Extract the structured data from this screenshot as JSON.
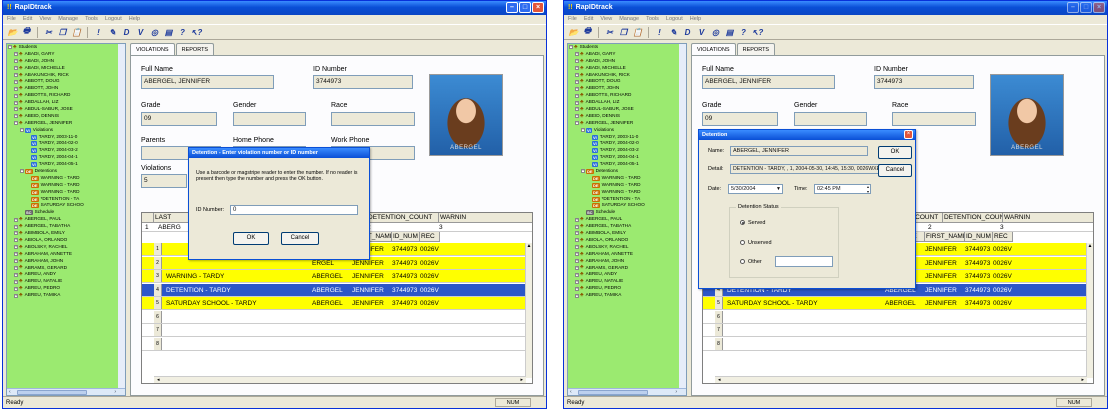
{
  "app": {
    "title": "RapIDtrack",
    "logo": "!!",
    "menu": [
      "File",
      "Edit",
      "View",
      "Manage",
      "Tools",
      "Logout",
      "Help"
    ],
    "toolbar_icons": [
      "folder-icon",
      "print-icon",
      "cut-icon",
      "copy-icon",
      "paste-icon",
      "exclamation-icon",
      "pen-icon",
      "D",
      "V",
      "binoculars-icon",
      "tray-icon",
      "question-icon",
      "help-pointer-icon"
    ],
    "status": "Ready",
    "num": "NUM"
  },
  "tree": {
    "root": "Students",
    "students_before": [
      "ABADI, GARY",
      "ABADI, JOHN",
      "ABADI, MICHELLE",
      "ABAKUNCHIK, RICK",
      "ABBOTT, DOUG",
      "ABBOTT, JOHN",
      "ABBOTTS, RICHARD",
      "ABDALLAH, LIZ",
      "ABDUL-SABUR, JOSE",
      "ABEID, DENNIS",
      "ABERGEL, JENNIFER"
    ],
    "violations_label": "Violations",
    "violations": [
      "TARDY, 2003-11-0",
      "TARDY, 2004-02-0",
      "TARDY, 2004-03-2",
      "TARDY, 2004-04-1",
      "TARDY, 2004-05-1"
    ],
    "detentions_label": "Detentions",
    "detentions": [
      "WARNING - TARD",
      "WARNING - TARD",
      "WARNING - TARD",
      "*DETENTION - TA",
      "SATURDAY SCHOO"
    ],
    "schedule_label": "Schedule",
    "students_after": [
      "ABERGEL, PAUL",
      "ABERGEL, TABATHA",
      "ABIMBOLA, EMILY",
      "ABIOLA, ORLANDO",
      "ABOLSKY, RACHEL",
      "ABRAHAM, ANNETTE",
      "ABRAHAM, JOHN",
      "ABRAMS, GERARD",
      "ABREU, ANDY",
      "ABREU, NATALIE",
      "ABREU, PEDRO",
      "ABREU, TAMIKA"
    ]
  },
  "tabs": [
    "VIOLATIONS",
    "REPORTS"
  ],
  "form": {
    "full_name_label": "Full Name",
    "full_name": "ABERGEL, JENNIFER",
    "id_label": "ID Number",
    "id_value": "3744973",
    "grade_label": "Grade",
    "grade": "09",
    "gender_label": "Gender",
    "race_label": "Race",
    "parents_label": "Parents",
    "home_phone_label": "Home Phone",
    "work_phone_label": "Work Phone",
    "violations_label": "Violations",
    "violations_count": "5",
    "photo_caption": "ABERGEL"
  },
  "grid": {
    "top_headers": [
      "LAST",
      "TION_COUNT",
      "DETENTION_COUNT",
      "WARNIN"
    ],
    "top_values": [
      "1",
      "ABERG",
      "2",
      "3"
    ],
    "headers": [
      "ST_NAME",
      "FIRST_NAME",
      "ID_NUM",
      "REC"
    ],
    "rows": [
      {
        "n": "1",
        "desc": "",
        "last": "ERGEL",
        "first": "JENNIFER",
        "id": "3744973",
        "rec": "0026V",
        "style": "yellow"
      },
      {
        "n": "2",
        "desc": "",
        "last": "ERGEL",
        "first": "JENNIFER",
        "id": "3744973",
        "rec": "0026V",
        "style": "yellow"
      },
      {
        "n": "3",
        "desc": "WARNING - TARDY",
        "last": "ABERGEL",
        "first": "JENNIFER",
        "id": "3744973",
        "rec": "0026V",
        "style": "yellow"
      },
      {
        "n": "4",
        "desc": "DETENTION - TARDY",
        "last": "ABERGEL",
        "first": "JENNIFER",
        "id": "3744973",
        "rec": "0026V",
        "style": "blue"
      },
      {
        "n": "5",
        "desc": "SATURDAY SCHOOL - TARDY",
        "last": "ABERGEL",
        "first": "JENNIFER",
        "id": "3744973",
        "rec": "0026V",
        "style": "yellow"
      },
      {
        "n": "6",
        "desc": "",
        "last": "",
        "first": "",
        "id": "",
        "rec": "",
        "style": ""
      },
      {
        "n": "7",
        "desc": "",
        "last": "",
        "first": "",
        "id": "",
        "rec": "",
        "style": ""
      },
      {
        "n": "8",
        "desc": "",
        "last": "",
        "first": "",
        "id": "",
        "rec": "",
        "style": ""
      }
    ]
  },
  "dialog1": {
    "title": "Detention - Enter violation number or ID number",
    "instructions": "Use a barcode or magstripe reader to enter the number. If no reader is present then type the number and press the OK button.",
    "id_label": "ID Number:",
    "id_value": "0",
    "ok": "OK",
    "cancel": "Cancel"
  },
  "dialog2": {
    "title": "Detention",
    "name_label": "Name:",
    "name_value": "ABERGEL, JENNIFER",
    "detail_label": "Detail:",
    "detail_value": "DETENTION - TARDY, , 1, 2004-05-30, 14:45, 15:30, 0026WXE",
    "date_label": "Date:",
    "date_value": "5/30/2004",
    "time_label": "Time:",
    "time_value": "02:45 PM",
    "status_label": "Detention Status",
    "served": "Served",
    "unserved": "Unserved",
    "other": "Other",
    "ok": "OK",
    "cancel": "Cancel"
  }
}
